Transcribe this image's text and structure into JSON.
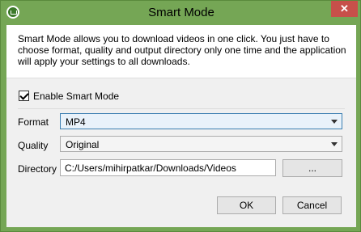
{
  "window": {
    "title": "Smart Mode",
    "close_label": "✕"
  },
  "header": {
    "description": "Smart Mode allows you to download videos in one click. You just have to choose format, quality and output directory only one time and the application will apply your settings to all downloads."
  },
  "enable_smart_mode": {
    "label": "Enable Smart Mode",
    "checked": true
  },
  "format": {
    "label": "Format",
    "value": "MP4"
  },
  "quality": {
    "label": "Quality",
    "value": "Original"
  },
  "directory": {
    "label": "Directory",
    "value": "C:/Users/mihirpatkar/Downloads/Videos",
    "browse_label": "..."
  },
  "buttons": {
    "ok": "OK",
    "cancel": "Cancel"
  }
}
